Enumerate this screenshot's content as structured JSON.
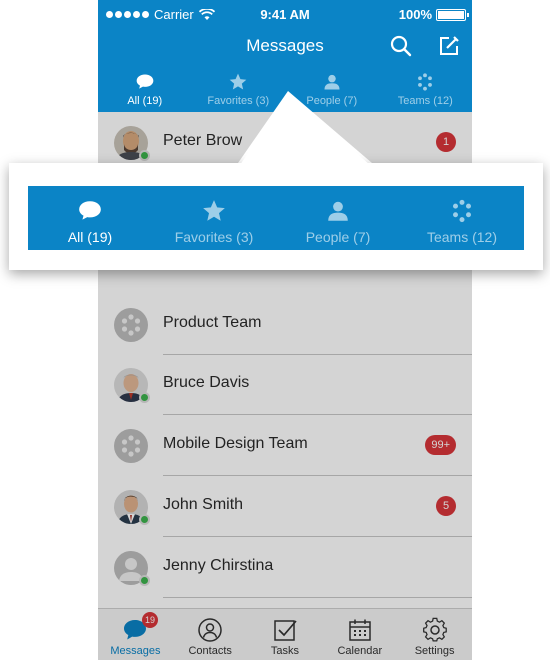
{
  "status_bar": {
    "carrier": "Carrier",
    "time": "9:41 AM",
    "battery": "100%"
  },
  "nav": {
    "title": "Messages"
  },
  "tabs": [
    {
      "label": "All (19)",
      "icon": "chat-bubble-icon",
      "active": true
    },
    {
      "label": "Favorites (3)",
      "icon": "star-icon",
      "active": false
    },
    {
      "label": "People (7)",
      "icon": "person-icon",
      "active": false
    },
    {
      "label": "Teams (12)",
      "icon": "dots-circle-icon",
      "active": false
    }
  ],
  "conversations": [
    {
      "name": "Peter Brow",
      "badge": "1",
      "online": true
    },
    {
      "name": "Product Team",
      "badge": "",
      "online": false
    },
    {
      "name": "Bruce Davis",
      "badge": "",
      "online": true
    },
    {
      "name": "Mobile Design Team",
      "badge": "99+",
      "online": false
    },
    {
      "name": "John Smith",
      "badge": "5",
      "online": true
    },
    {
      "name": "Jenny Chirstina",
      "badge": "",
      "online": true
    }
  ],
  "bottom_tabs": [
    {
      "label": "Messages",
      "icon": "chat-icon",
      "active": true,
      "badge": "19"
    },
    {
      "label": "Contacts",
      "icon": "contact-icon",
      "active": false
    },
    {
      "label": "Tasks",
      "icon": "task-checkbox-icon",
      "active": false
    },
    {
      "label": "Calendar",
      "icon": "calendar-icon",
      "active": false
    },
    {
      "label": "Settings",
      "icon": "gear-icon",
      "active": false
    }
  ],
  "colors": {
    "brand": "#0b84c6",
    "badge": "#d9363a",
    "online": "#3db34d"
  }
}
